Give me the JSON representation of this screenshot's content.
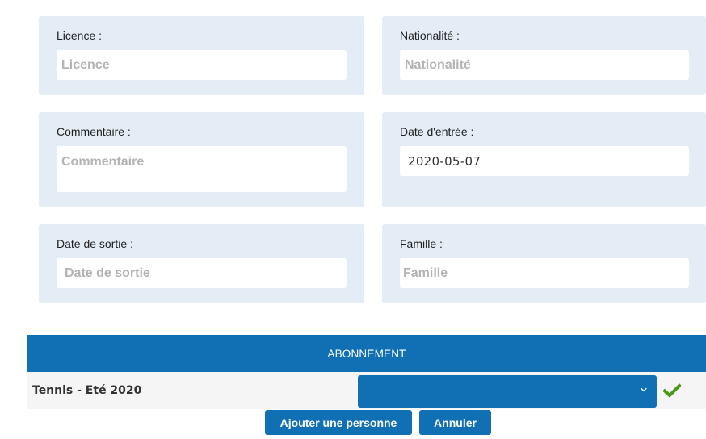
{
  "form": {
    "licence": {
      "label": "Licence :",
      "placeholder": "Licence",
      "value": ""
    },
    "nationalite": {
      "label": "Nationalité :",
      "placeholder": "Nationalité",
      "value": ""
    },
    "commentaire": {
      "label": "Commentaire :",
      "placeholder": "Commentaire",
      "value": ""
    },
    "date_entree": {
      "label": "Date d'entrée :",
      "placeholder": "Date d'entrée",
      "value": "2020-05-07"
    },
    "date_sortie": {
      "label": "Date de sortie :",
      "placeholder": "Date de sortie",
      "value": ""
    },
    "famille": {
      "label": "Famille :",
      "placeholder": "Famille",
      "value": ""
    }
  },
  "subscription": {
    "header": "ABONNEMENT",
    "item_name": "Tennis - Eté 2020",
    "select_value": ""
  },
  "actions": {
    "add_person_label": "Ajouter une personne",
    "cancel_label": "Annuler"
  },
  "colors": {
    "card_bg": "#e4edf6",
    "accent": "#1170b4",
    "check": "#4a9a1a"
  },
  "icons": {
    "dropdown": "chevron-down-icon",
    "confirm": "check-icon"
  }
}
